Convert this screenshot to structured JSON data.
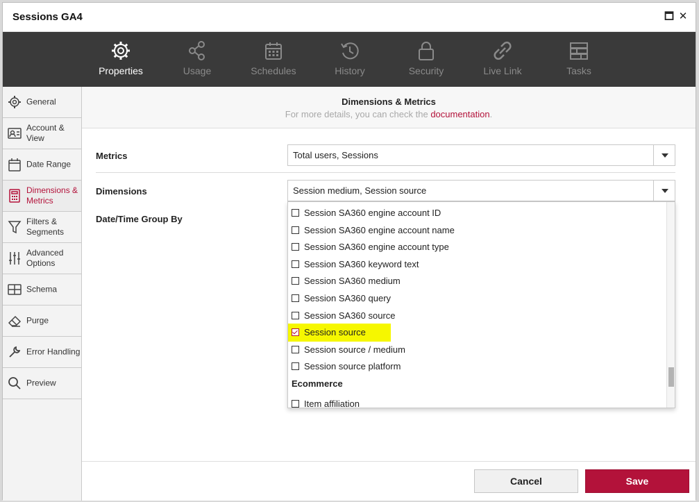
{
  "window": {
    "title": "Sessions GA4",
    "maximize_icon": "maximize-icon",
    "close_icon": "close-icon",
    "maximize_glyph": "🗖",
    "close_glyph": "✕"
  },
  "toolbar": {
    "items": [
      {
        "label": "Properties",
        "icon": "gear-icon",
        "active": true
      },
      {
        "label": "Usage",
        "icon": "share-icon",
        "active": false
      },
      {
        "label": "Schedules",
        "icon": "calendar-icon",
        "active": false
      },
      {
        "label": "History",
        "icon": "history-icon",
        "active": false
      },
      {
        "label": "Security",
        "icon": "lock-icon",
        "active": false
      },
      {
        "label": "Live Link",
        "icon": "link-icon",
        "active": false
      },
      {
        "label": "Tasks",
        "icon": "tasks-icon",
        "active": false
      }
    ]
  },
  "sidebar": {
    "items": [
      {
        "label": "General",
        "icon": "gear-icon"
      },
      {
        "label": "Account & View",
        "icon": "id-card-icon"
      },
      {
        "label": "Date Range",
        "icon": "calendar-icon"
      },
      {
        "label": "Dimensions & Metrics",
        "icon": "calculator-icon",
        "active": true
      },
      {
        "label": "Filters & Segments",
        "icon": "filter-icon"
      },
      {
        "label": "Advanced Options",
        "icon": "sliders-icon"
      },
      {
        "label": "Schema",
        "icon": "table-icon"
      },
      {
        "label": "Purge",
        "icon": "eraser-icon"
      },
      {
        "label": "Error Handling",
        "icon": "wrench-icon"
      },
      {
        "label": "Preview",
        "icon": "search-icon"
      }
    ]
  },
  "header": {
    "title": "Dimensions & Metrics",
    "subtitle_prefix": "For more details, you can check the ",
    "subtitle_link": "documentation",
    "subtitle_suffix": "."
  },
  "form": {
    "metrics_label": "Metrics",
    "metrics_value": "Total users, Sessions",
    "dimensions_label": "Dimensions",
    "dimensions_value": "Session medium, Session source",
    "groupby_label": "Date/Time Group By"
  },
  "dropdown": {
    "options": [
      {
        "label": "Session SA360 engine account ID",
        "checked": false
      },
      {
        "label": "Session SA360 engine account name",
        "checked": false
      },
      {
        "label": "Session SA360 engine account type",
        "checked": false
      },
      {
        "label": "Session SA360 keyword text",
        "checked": false
      },
      {
        "label": "Session SA360 medium",
        "checked": false
      },
      {
        "label": "Session SA360 query",
        "checked": false
      },
      {
        "label": "Session SA360 source",
        "checked": false
      },
      {
        "label": "Session source",
        "checked": true
      },
      {
        "label": "Session source / medium",
        "checked": false
      },
      {
        "label": "Session source platform",
        "checked": false
      }
    ],
    "group_label": "Ecommerce",
    "after_group": [
      {
        "label": "Item affiliation",
        "checked": false
      }
    ],
    "highlight_color": "#f6f700"
  },
  "footer": {
    "cancel_label": "Cancel",
    "save_label": "Save"
  },
  "colors": {
    "accent": "#b3123a",
    "toolbar_bg": "#3a3a3a"
  }
}
